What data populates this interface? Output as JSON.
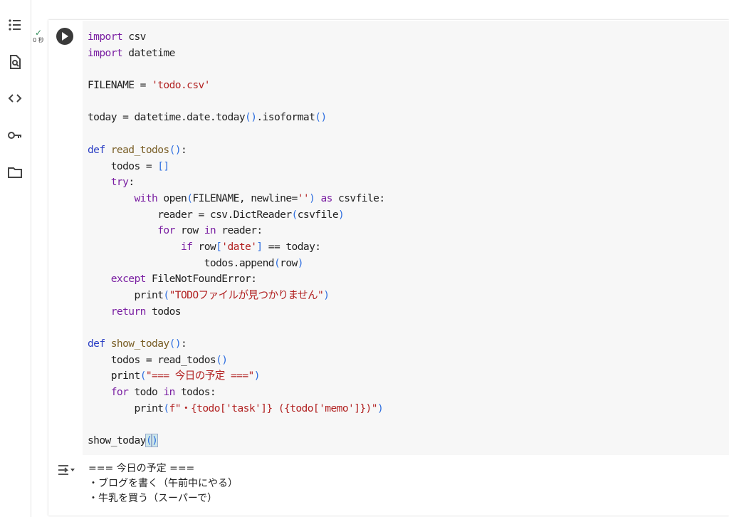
{
  "sidebar": {
    "items": [
      {
        "icon": "table-of-contents-icon"
      },
      {
        "icon": "find-replace-icon"
      },
      {
        "icon": "code-snippets-icon"
      },
      {
        "icon": "secrets-key-icon"
      },
      {
        "icon": "files-folder-icon"
      }
    ]
  },
  "cell": {
    "status_check": "✓",
    "exec_time": "0 秒",
    "code_lines": [
      "import csv",
      "import datetime",
      "",
      "FILENAME = 'todo.csv'",
      "",
      "today = datetime.date.today().isoformat()",
      "",
      "def read_todos():",
      "    todos = []",
      "    try:",
      "        with open(FILENAME, newline='') as csvfile:",
      "            reader = csv.DictReader(csvfile)",
      "            for row in reader:",
      "                if row['date'] == today:",
      "                    todos.append(row)",
      "    except FileNotFoundError:",
      "        print(\"TODOファイルが見つかりません\")",
      "    return todos",
      "",
      "def show_today():",
      "    todos = read_todos()",
      "    print(\"=== 今日の予定 ===\")",
      "    for todo in todos:",
      "        print(f\"・{todo['task']} ({todo['memo']})\")",
      "",
      "show_today()"
    ]
  },
  "output": {
    "lines": [
      "=== 今日の予定 ===",
      "・ブログを書く（午前中にやる）",
      "・牛乳を買う（スーパーで）"
    ]
  }
}
